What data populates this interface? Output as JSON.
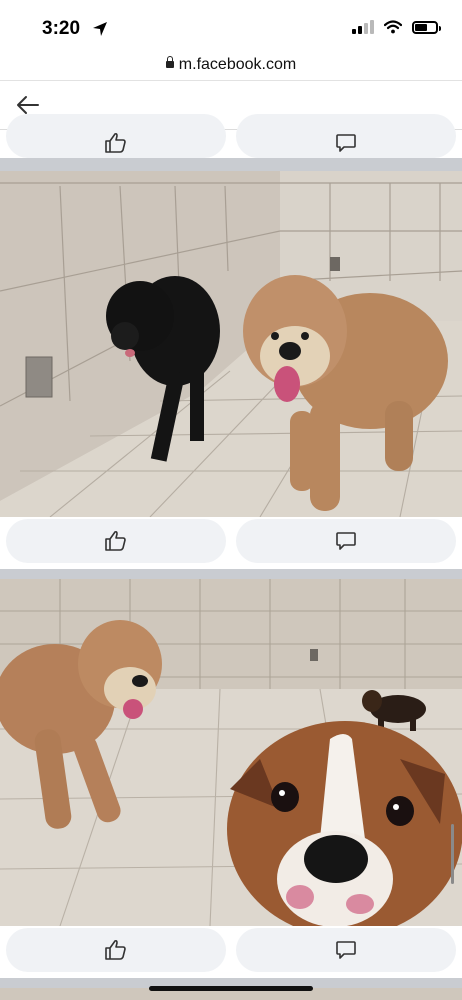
{
  "status_bar": {
    "time": "3:20",
    "icons": [
      "location-arrow-icon",
      "signal-icon",
      "wifi-icon",
      "battery-icon"
    ],
    "signal_bars": 2,
    "battery_level": 0.55
  },
  "browser": {
    "url": "m.facebook.com",
    "icons": [
      "lock-icon"
    ]
  },
  "nav": {
    "icons": [
      "back-arrow-icon"
    ]
  },
  "posts": [
    {
      "photo": "two dogs standing in a tiled room",
      "actions": [
        "like-icon",
        "comment-icon"
      ]
    },
    {
      "photo": "three dogs in a tiled room, one close to camera",
      "actions": [
        "like-icon",
        "comment-icon"
      ]
    }
  ],
  "colors": {
    "feed_background": "#c9ccd1",
    "button_background": "#f0f2f5",
    "tile": "#d8d2c9"
  }
}
